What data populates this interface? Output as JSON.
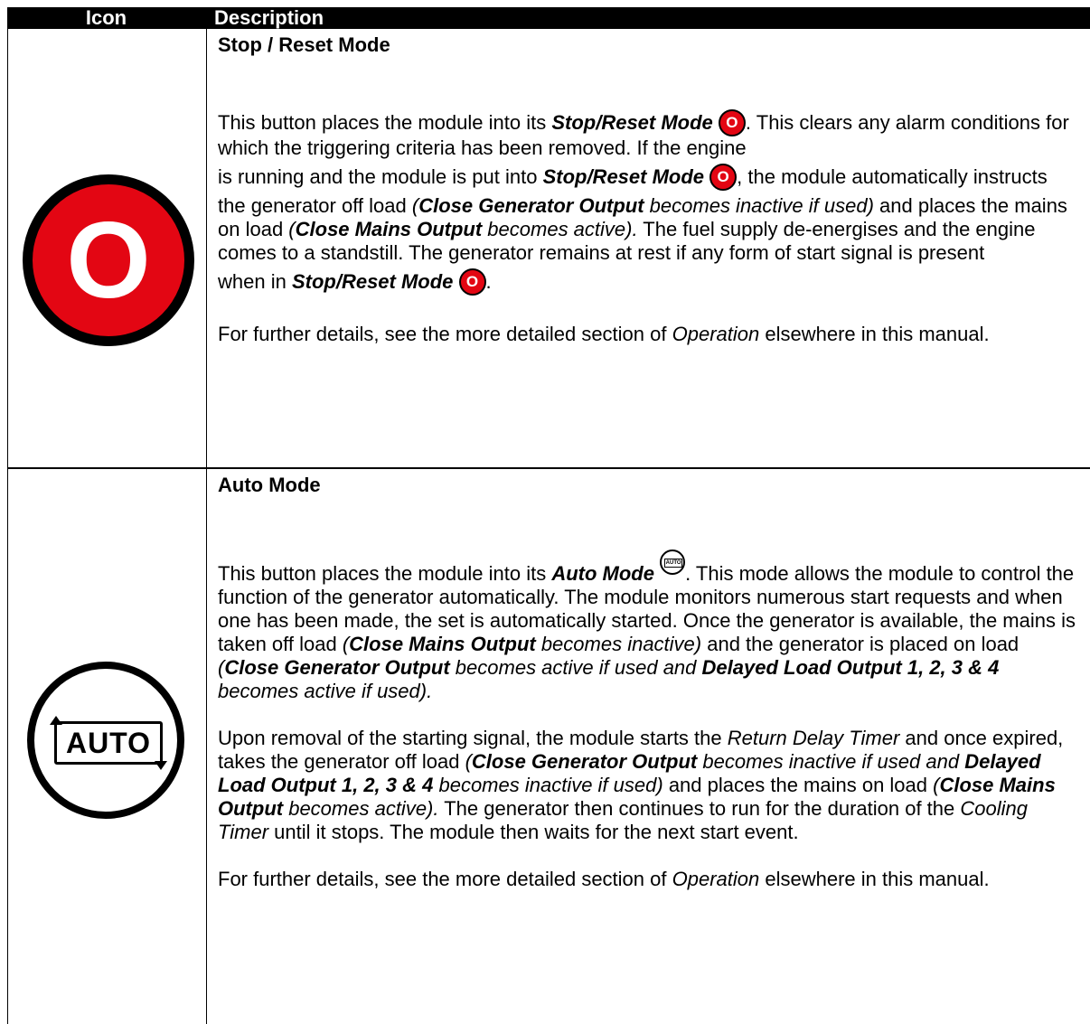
{
  "header": {
    "icon": "Icon",
    "description": "Description"
  },
  "rows": [
    {
      "icon_name": "stop-reset-icon",
      "icon_glyph": "O",
      "title": "Stop / Reset Mode",
      "p1_a": "This button places the module into its ",
      "p1_b": "Stop/Reset Mode",
      "p1_c": ". This clears any alarm conditions for which the triggering criteria has been removed. If the engine",
      "p1_d": "is running and the module is put into ",
      "p1_e": "Stop/Reset Mode",
      "p1_f": ", the module automatically instructs the generator off load ",
      "p1_g": "(",
      "p1_h": "Close Generator Output",
      "p1_i": " becomes inactive if used)",
      "p1_j": " and places the mains on load ",
      "p1_k": "(",
      "p1_l": "Close Mains Output",
      "p1_m": " becomes active).",
      "p1_n": " The fuel supply de-energises and the engine comes to a standstill. The generator remains at rest if any form of start signal is present",
      "p1_o": "when in ",
      "p1_p": "Stop/Reset Mode",
      "p1_q": ".",
      "p2_a": "For further details, see the more detailed section of ",
      "p2_b": "Operation",
      "p2_c": " elsewhere in this manual."
    },
    {
      "icon_name": "auto-mode-icon",
      "icon_label": "AUTO",
      "inline_label": "AUTO",
      "title": "Auto Mode",
      "p1_a": "This button places the module into its ",
      "p1_b": "Auto Mode",
      "p1_c": ". This mode allows the module to control the function of the generator automatically. The module monitors numerous start requests and when one has been made, the set is automatically started. Once the generator is available, the mains is taken off load ",
      "p1_d": "(",
      "p1_e": "Close Mains Output",
      "p1_f": " becomes inactive)",
      "p1_g": " and the generator is placed on load ",
      "p1_h": "(",
      "p1_i": "Close Generator Output",
      "p1_j": " becomes active if used and ",
      "p1_k": "Delayed Load Output 1, 2, 3 & 4",
      "p1_l": " becomes active if used).",
      "p2_a": "Upon removal of the starting signal, the module starts the ",
      "p2_b": "Return Delay Timer",
      "p2_c": " and once expired, takes the generator off load ",
      "p2_d": "(",
      "p2_e": "Close Generator Output",
      "p2_f": " becomes inactive if used and ",
      "p2_g": "Delayed Load Output 1, 2, 3 & 4",
      "p2_h": " becomes inactive if used)",
      "p2_i": " and places the mains on load ",
      "p2_j": "(",
      "p2_k": "Close Mains Output",
      "p2_l": " becomes active).",
      "p2_m": " The generator then continues to run for the duration of the ",
      "p2_n": "Cooling Timer",
      "p2_o": " until it stops. The module then waits for the next start event.",
      "p3_a": "For further details, see the more detailed section of ",
      "p3_b": "Operation",
      "p3_c": " elsewhere in this manual."
    }
  ],
  "colors": {
    "stop_red": "#e30613",
    "header_bg": "#000000",
    "header_text": "#ffffff"
  }
}
